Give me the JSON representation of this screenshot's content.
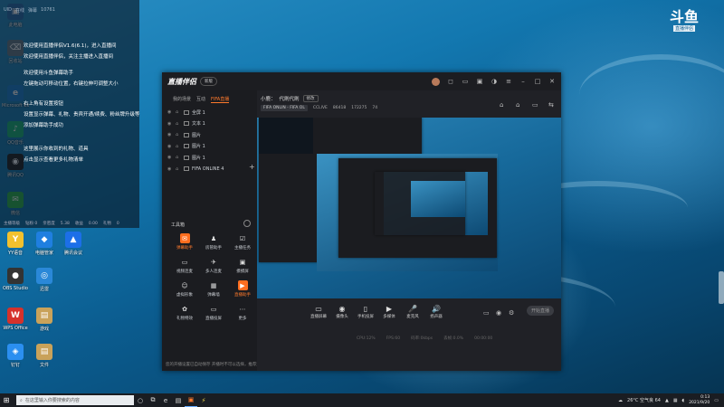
{
  "desktop": {
    "icons": [
      {
        "label": "此电脑",
        "glyph": "▣",
        "color": "#2a6fb0"
      },
      {
        "label": "回收站",
        "glyph": "⌫",
        "color": "#6a7b8a"
      },
      {
        "label": "Microsoft Edge",
        "glyph": "e",
        "color": "#1f84d6"
      },
      {
        "label": "QQ音乐",
        "glyph": "♪",
        "color": "#1cb87a"
      },
      {
        "label": "腾讯QQ",
        "glyph": "◉",
        "color": "#222"
      },
      {
        "label": "微信",
        "glyph": "✉",
        "color": "#2db84d"
      },
      {
        "label": "YY语音",
        "glyph": "Y",
        "color": "#f2c12e"
      },
      {
        "label": "电脑管家",
        "glyph": "◆",
        "color": "#1f7fe0"
      },
      {
        "label": "腾讯会议",
        "glyph": "▲",
        "color": "#1c6fe8"
      },
      {
        "label": "OBS Studio",
        "glyph": "●",
        "color": "#333"
      },
      {
        "label": "迅雷",
        "glyph": "◎",
        "color": "#2a88d8"
      },
      {
        "label": "WPS Office",
        "glyph": "W",
        "color": "#d6312b"
      },
      {
        "label": "游戏",
        "glyph": "▤",
        "color": "#c9a25a"
      },
      {
        "label": "钉钉",
        "glyph": "◈",
        "color": "#2b8ff0"
      },
      {
        "label": "文件",
        "glyph": "▤",
        "color": "#c9a25a"
      }
    ]
  },
  "chat": {
    "top_stats": [
      "UID",
      "在线",
      "弹幕",
      "10761"
    ],
    "lines": [
      "欢迎使用直播伴侣V1.6(6.1)，进入直播间",
      "欢迎使用直播伴侣，关注主播进入直播间",
      "欢迎使用斗鱼弹幕助手",
      "左键拖动可移动位置，右键拉伸可调整大小",
      "右上角有设置按钮",
      "设置显示弹幕、礼物、贵宾开通/续费、粉丝牌升级等",
      "添加弹幕助手成功",
      "这里展示你收到的礼物、道具",
      "点击显示查看更多礼物清单"
    ],
    "bottom": [
      "主播等级",
      "钻粉 0",
      "亲密度",
      "5.38",
      "收益",
      "0.00",
      "礼物",
      "0"
    ]
  },
  "app": {
    "logo": "直播伴侣",
    "version_button": "新版",
    "title_icons": [
      "bell-icon",
      "message-icon",
      "gift-icon",
      "skin-icon",
      "menu-icon",
      "minimize-icon",
      "maximize-icon",
      "close-icon"
    ],
    "tabs": [
      "我的场景",
      "互动",
      "FIFA直播"
    ],
    "active_tab": 2,
    "scenes": [
      "全屏 1",
      "文本 1",
      "图片",
      "图片 1",
      "图片 1",
      "FIFA ONLINE 4"
    ],
    "tools_title": "工具箱",
    "tools": [
      {
        "label": "弹幕助手",
        "highlight": true,
        "glyph": "✉"
      },
      {
        "label": "房管助手",
        "highlight": false,
        "glyph": "♟"
      },
      {
        "label": "主播任务",
        "highlight": false,
        "glyph": "☑"
      },
      {
        "label": "视频连麦",
        "highlight": false,
        "glyph": "▭"
      },
      {
        "label": "多人连麦",
        "highlight": false,
        "glyph": "✈"
      },
      {
        "label": "摸摸屏",
        "highlight": false,
        "glyph": "▣"
      },
      {
        "label": "虚拟形象",
        "highlight": false,
        "glyph": "☺"
      },
      {
        "label": "弹幕墙",
        "highlight": false,
        "glyph": "▦"
      },
      {
        "label": "直播助手",
        "highlight": true,
        "glyph": "▶"
      },
      {
        "label": "礼物特效",
        "highlight": false,
        "glyph": "✿"
      },
      {
        "label": "直播投屏",
        "highlight": false,
        "glyph": "▭"
      },
      {
        "label": "更多",
        "highlight": false,
        "glyph": "⋯"
      }
    ],
    "footer_notice": "您的开播设置已自动保存 开播时不可以选择，推荐还有大量功能",
    "room": {
      "title_prefix": "小鹿：",
      "title": "代刷代刷",
      "modify_button": "修改",
      "game_tag": "FIFA ONLIN - FIFA OL",
      "live_tag": "CCLIVE",
      "viewers": "86418",
      "hot": "172275",
      "fans": "74"
    },
    "top_right_icons": [
      "lock-icon",
      "lock-icon",
      "screen-icon",
      "share-icon"
    ],
    "controls": [
      {
        "label": "直播屏幕",
        "glyph": "▭"
      },
      {
        "label": "摄像头",
        "glyph": "◉"
      },
      {
        "label": "手机投屏",
        "glyph": "▯"
      },
      {
        "label": "多媒体",
        "glyph": "▶"
      },
      {
        "label": "麦克风",
        "glyph": "🎤"
      },
      {
        "label": "扬声器",
        "glyph": "🔊"
      }
    ],
    "extra_controls": [
      "record-icon",
      "eye-icon",
      "settings-icon"
    ],
    "live_button": "开始直播",
    "status": [
      "CPU:12%",
      "FPS:60",
      "码率:0kbps",
      "丢帧:0.0%",
      "00:00:00"
    ]
  },
  "brand": {
    "name": "斗鱼",
    "tag": "直播伴侣"
  },
  "taskbar": {
    "search_placeholder": "在这里输入你要搜索的内容",
    "tray_weather": "26°C 空气良 64",
    "time": "0:13",
    "date": "2021/9/20"
  }
}
